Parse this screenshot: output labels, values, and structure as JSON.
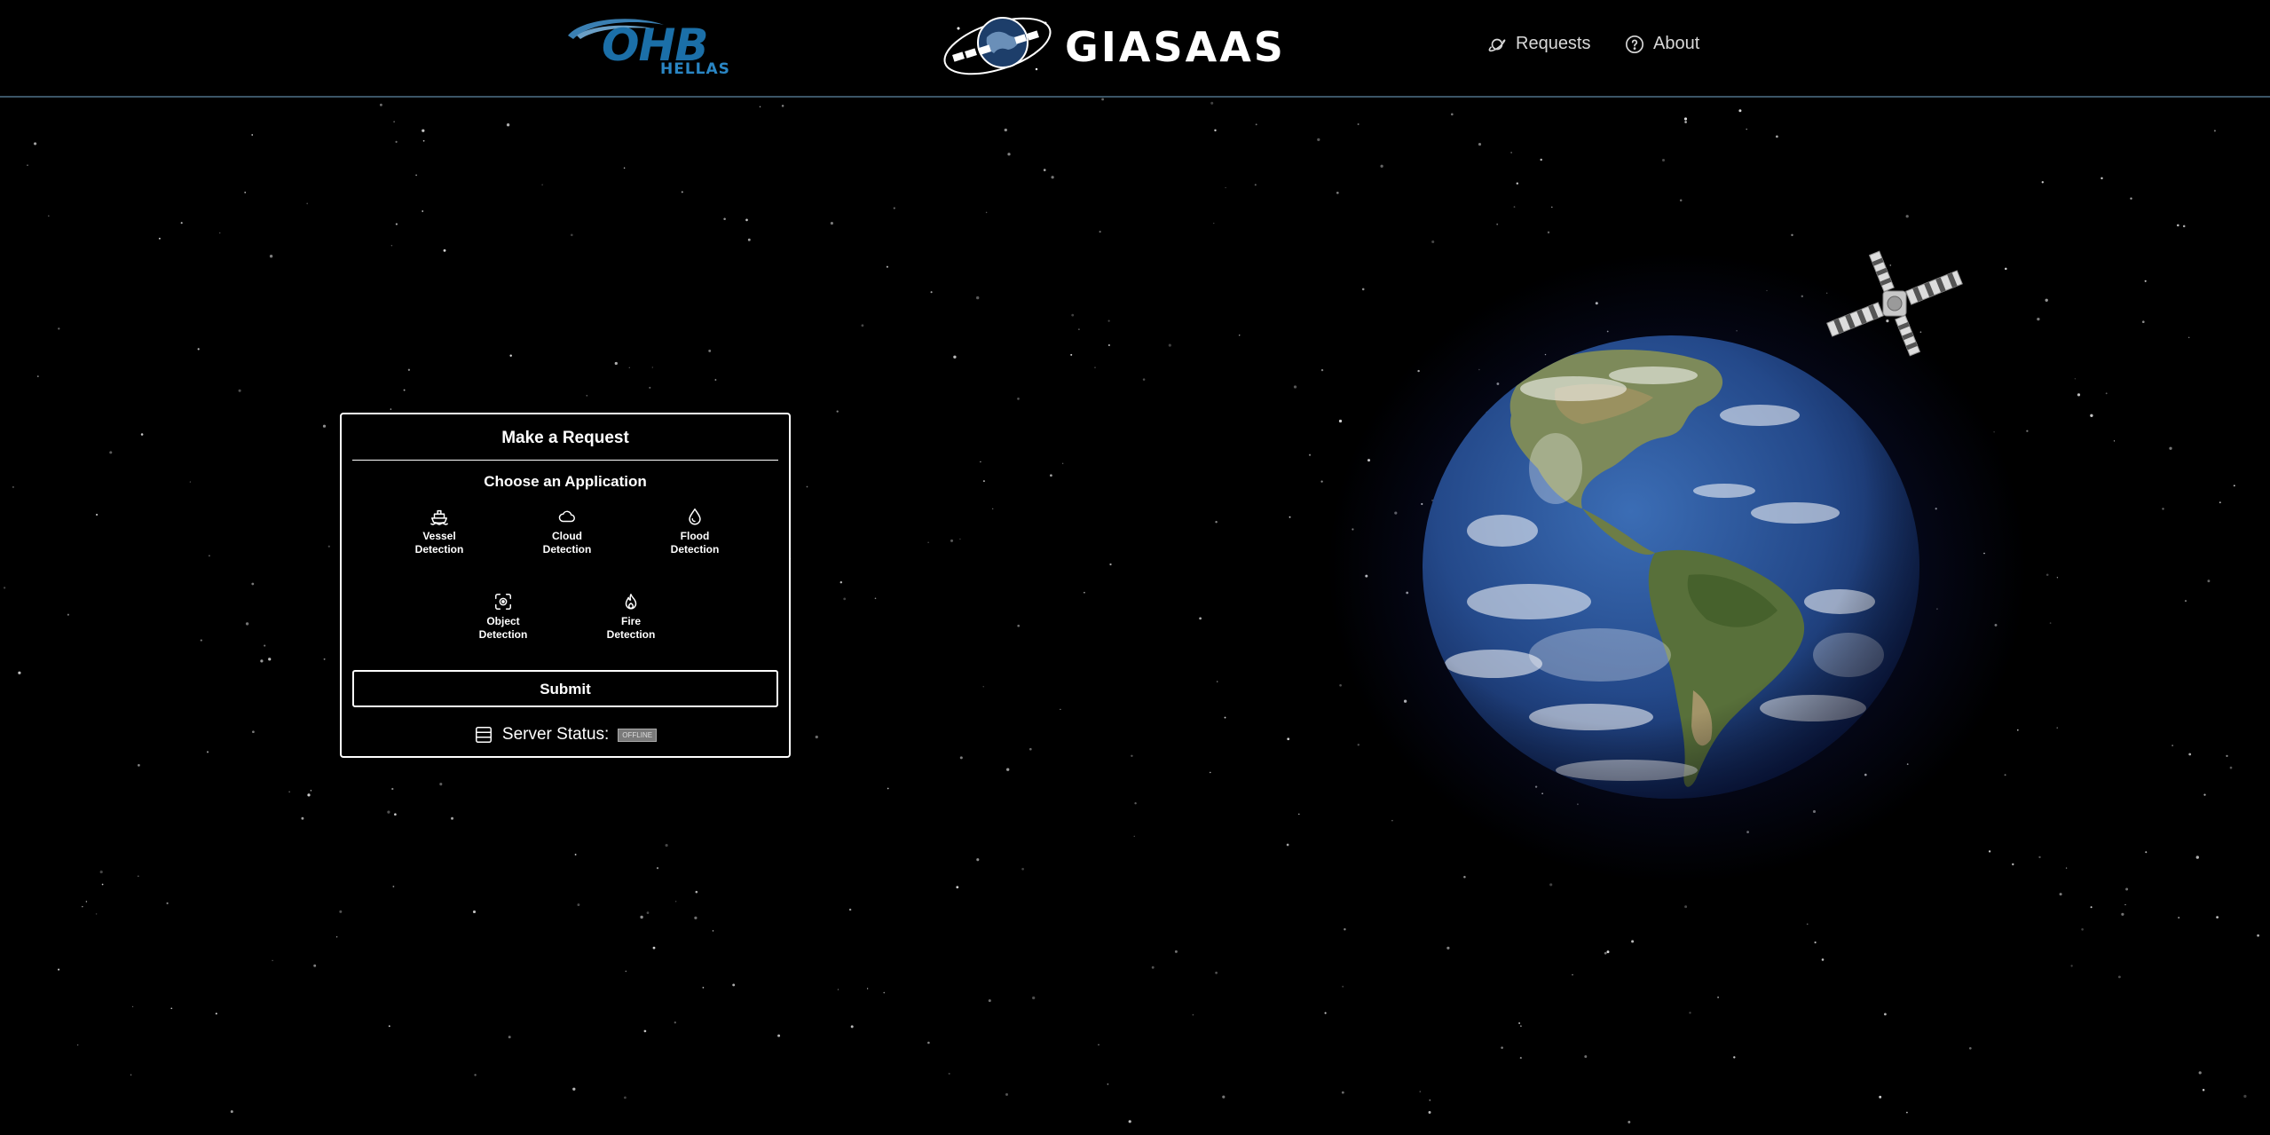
{
  "header": {
    "partner_logo": {
      "main": "OHB",
      "sub": "HELLAS"
    },
    "brand_name": "GIASAAS",
    "nav": [
      {
        "label": "Requests",
        "icon": "planet-icon"
      },
      {
        "label": "About",
        "icon": "help-circle-icon"
      }
    ]
  },
  "request_panel": {
    "title": "Make a Request",
    "subtitle": "Choose an Application",
    "applications": [
      {
        "line1": "Vessel",
        "line2": "Detection",
        "icon": "ship-icon"
      },
      {
        "line1": "Cloud",
        "line2": "Detection",
        "icon": "cloud-icon"
      },
      {
        "line1": "Flood",
        "line2": "Detection",
        "icon": "droplet-icon"
      },
      {
        "line1": "Object",
        "line2": "Detection",
        "icon": "focus-scan-icon"
      },
      {
        "line1": "Fire",
        "line2": "Detection",
        "icon": "flame-icon"
      }
    ],
    "submit_label": "Submit",
    "server_status_label": "Server Status:",
    "server_status_value": "OFFLINE",
    "server_icon": "server-icon"
  },
  "colors": {
    "background": "#000000",
    "ohb_blue": "#1b6fa8",
    "header_border": "#3b5566",
    "status_badge": "#7a7a7a"
  }
}
